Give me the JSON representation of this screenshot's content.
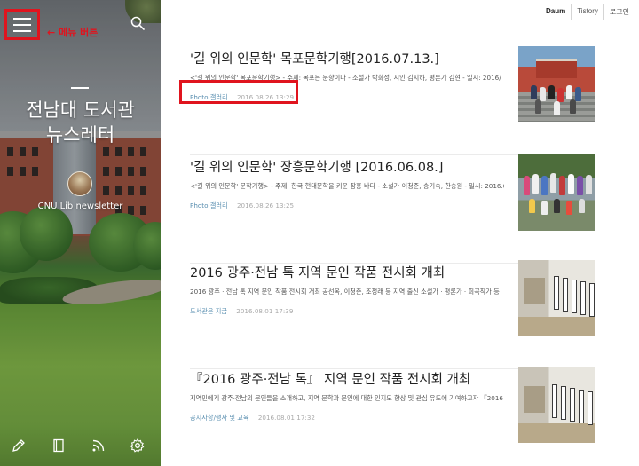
{
  "sidebar": {
    "menu_note": "← 메뉴 버튼",
    "blog_title_line1": "전남대 도서관",
    "blog_title_line2": "뉴스레터",
    "blog_subtitle": "CNU Lib newsletter",
    "tools": [
      "pencil-icon",
      "book-icon",
      "rss-icon",
      "gear-icon"
    ]
  },
  "top_links": [
    "Daum",
    "Tistory",
    "로그인"
  ],
  "posts": [
    {
      "title": "'길 위의 인문학' 목포문학기행[2016.07.13.]",
      "excerpt": "<'길 위의 인문학' 목포문학기행> - 주제: 목포는 문향이다 - 소설가 박화성, 시인 김지하, 평론가 김현 - 일시: 2016/",
      "category": "Photo 갤러리",
      "date": "2016.08.26 13:29"
    },
    {
      "title": "'길 위의 인문학' 장흥문학기행 [2016.06.08.]",
      "excerpt": "<'길 위의 인문학' 문학기행> - 주제: 한국 현대문학을 키운 장흥 바다 - 소설가 이청준, 송기숙, 한승원 - 일시: 2016.0",
      "category": "Photo 갤러리",
      "date": "2016.08.26 13:25"
    },
    {
      "title": "2016 광주·전남 톡 지역 문인 작품 전시회 개최",
      "excerpt": "2016 광주 · 전남 톡 지역 문인 작품 전시회 개최 공선옥, 이청준, 조정래 등 지역 출신 소설가 · 평론가 · 희곡작가 등",
      "category": "도서관은 지금",
      "date": "2016.08.01 17:39"
    },
    {
      "title": "『2016 광주·전남 톡』 지역 문인 작품 전시회 개최",
      "excerpt": "지역민에게 광주·전남의 문인들을 소개하고, 지역 문학과 문인에 대한 인지도 향상 및 관심 유도에 기여하고자 『2016",
      "category": "공지사항/행사 및 교육",
      "date": "2016.08.01 17:32"
    }
  ],
  "colors": {
    "highlight": "#e0141e",
    "category": "#5a8fb0"
  }
}
